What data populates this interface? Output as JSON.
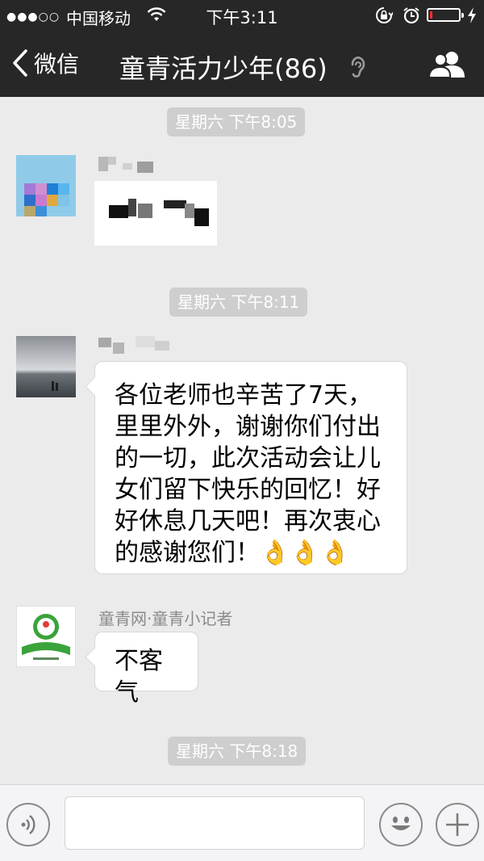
{
  "status_bar": {
    "signal": "●●●○○",
    "carrier": "中国移动",
    "time": "下午3:11",
    "icons": [
      "wifi-icon",
      "orientation-lock-icon",
      "alarm-icon",
      "battery-icon",
      "charging-bolt-icon"
    ],
    "battery_level": 0.1,
    "battery_color": "#ff2d2d"
  },
  "nav": {
    "back_label": "微信",
    "title": "童青活力少年(86)",
    "icons": [
      "back-chevron-icon",
      "earpiece-mode-icon",
      "group-members-icon"
    ]
  },
  "chat": {
    "timestamps": [
      "星期六 下午8:05",
      "星期六 下午8:11",
      "星期六 下午8:18"
    ],
    "messages": [
      {
        "sender": "",
        "text": "",
        "pixelated": true
      },
      {
        "sender": "",
        "text": "各位老师也辛苦了7天，里里外外，谢谢你们付出的一切，此次活动会让儿女们留下快乐的回忆！好好休息几天吧！再次衷心的感谢您们！",
        "emoji": "👌👌👌"
      },
      {
        "sender": "童青网·童青小记者",
        "text": "不客气"
      }
    ]
  },
  "input_bar": {
    "icons": [
      "voice-icon",
      "emoji-icon",
      "plus-icon"
    ],
    "input_value": ""
  },
  "colors": {
    "bar_background": "#272727",
    "chat_background": "#ebebeb",
    "timestamp_background": "#cecece",
    "bubble_background": "#ffffff"
  }
}
